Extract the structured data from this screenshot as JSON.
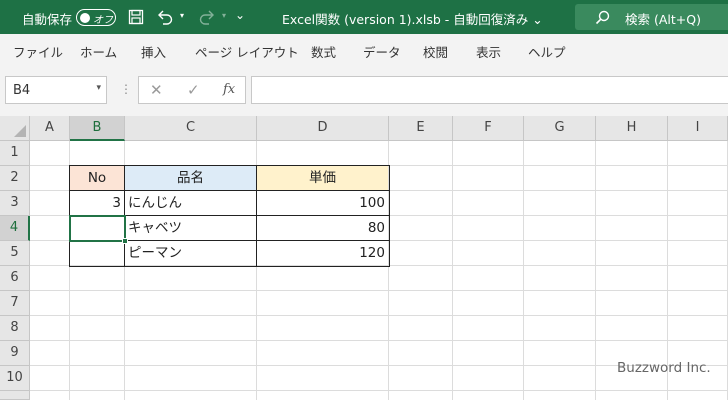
{
  "titlebar": {
    "autosave_label": "自動保存",
    "autosave_state": "オフ",
    "doc_title": "Excel関数 (version 1).xlsb  -  自動回復済み  ⌄",
    "search_label": "検索 (Alt+Q)",
    "qat_more": "⌄",
    "undo_caret": "▾",
    "redo_caret": "▾"
  },
  "ribbon": {
    "tabs": [
      "ファイル",
      "ホーム",
      "挿入",
      "ページ レイアウト",
      "数式",
      "データ",
      "校閲",
      "表示",
      "ヘルプ"
    ]
  },
  "formula_bar": {
    "name_box": "B4",
    "name_caret": "▾",
    "separator": "⋮",
    "cancel_glyph": "✕",
    "confirm_glyph": "✓",
    "fx_label": "fx",
    "formula": ""
  },
  "grid": {
    "columns": [
      "A",
      "B",
      "C",
      "D",
      "E",
      "F",
      "G",
      "H",
      "I"
    ],
    "rows": [
      "1",
      "2",
      "3",
      "4",
      "5",
      "6",
      "7",
      "8",
      "9",
      "10"
    ],
    "selected_cell": "B4",
    "table": {
      "headers": [
        "No",
        "品名",
        "単価"
      ],
      "rows": [
        {
          "no": "3",
          "name": "にんじん",
          "price": "100"
        },
        {
          "no": "",
          "name": "キャベツ",
          "price": "80"
        },
        {
          "no": "",
          "name": "ピーマン",
          "price": "120"
        }
      ]
    }
  },
  "watermark": "Buzzword Inc.",
  "colors": {
    "titlebar": "#1e7145",
    "accent": "#217346",
    "header_no": "#fce4d6",
    "header_name": "#ddebf7",
    "header_price": "#fff2cc"
  },
  "icons": [
    "save-icon",
    "undo-icon",
    "redo-icon",
    "search-icon",
    "corner-select-all-icon"
  ]
}
